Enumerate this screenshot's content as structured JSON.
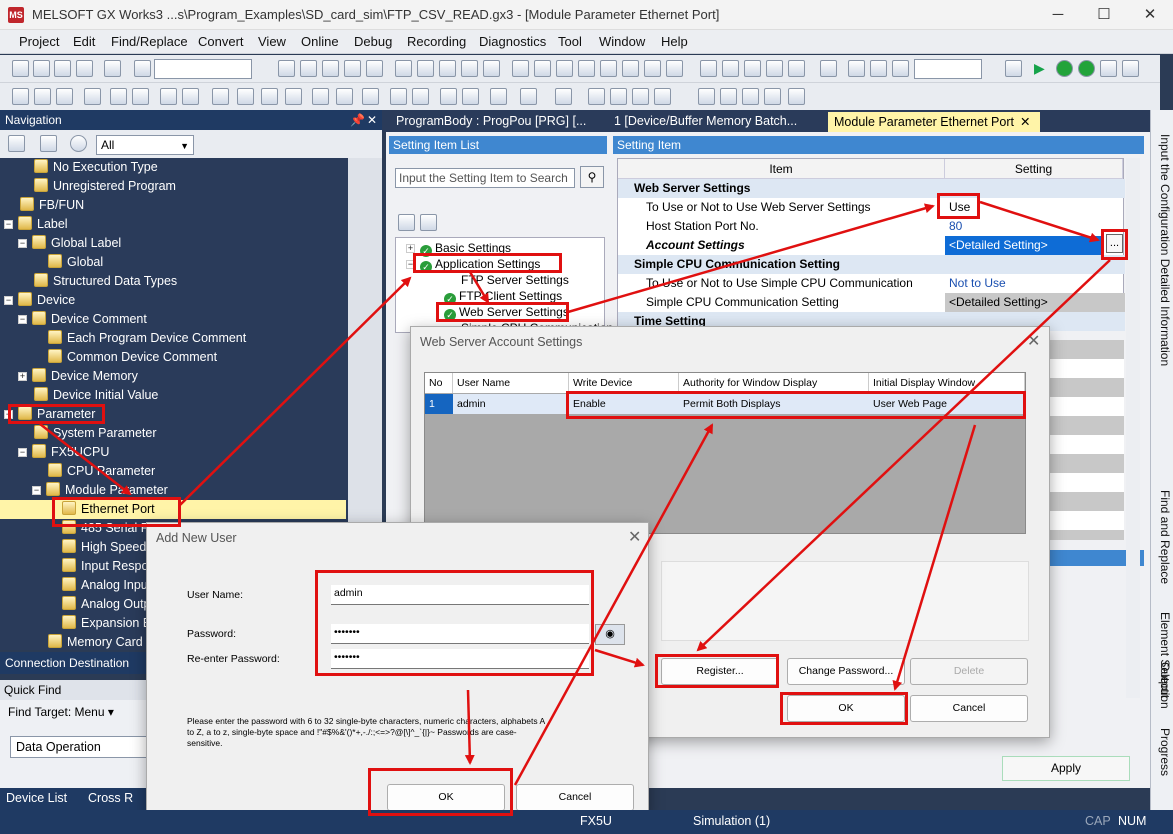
{
  "window": {
    "title": "MELSOFT GX Works3 ...s\\Program_Examples\\SD_card_sim\\FTP_CSV_READ.gx3 - [Module Parameter Ethernet Port]",
    "app_icon": "MELSOFT",
    "minimize": "─",
    "maximize": "☐",
    "close": "✕"
  },
  "menu": [
    "Project",
    "Edit",
    "Find/Replace",
    "Convert",
    "View",
    "Online",
    "Debug",
    "Recording",
    "Diagnostics",
    "Tool",
    "Window",
    "Help"
  ],
  "right_panel_tabs": [
    "Input the Configuration Detailed Information",
    "Find and Replace",
    "Element Selection",
    "Output",
    "Progress"
  ],
  "navigation": {
    "header": "Navigation",
    "pin": "📌",
    "close": "✕",
    "filter_value": "All",
    "items": [
      {
        "label": "No Execution Type",
        "expander": ""
      },
      {
        "label": "Unregistered Program",
        "expander": ""
      },
      {
        "label": "FB/FUN",
        "expander": ""
      },
      {
        "label": "Label",
        "expander": "−"
      },
      {
        "label": "Global Label",
        "expander": "−"
      },
      {
        "label": "Global",
        "expander": ""
      },
      {
        "label": "Structured Data Types",
        "expander": ""
      },
      {
        "label": "Device",
        "expander": "−"
      },
      {
        "label": "Device Comment",
        "expander": "−"
      },
      {
        "label": "Each Program Device Comment",
        "expander": ""
      },
      {
        "label": "Common Device Comment",
        "expander": ""
      },
      {
        "label": "Device Memory",
        "expander": "+"
      },
      {
        "label": "Device Initial Value",
        "expander": ""
      },
      {
        "label": "Parameter",
        "expander": "−"
      },
      {
        "label": "System Parameter",
        "expander": ""
      },
      {
        "label": "FX5UCPU",
        "expander": "−"
      },
      {
        "label": "CPU Parameter",
        "expander": ""
      },
      {
        "label": "Module Parameter",
        "expander": "−"
      },
      {
        "label": "Ethernet Port",
        "expander": ""
      },
      {
        "label": "485 Serial Port",
        "expander": ""
      },
      {
        "label": "High Speed I/O",
        "expander": ""
      },
      {
        "label": "Input Response Time",
        "expander": ""
      },
      {
        "label": "Analog Input",
        "expander": ""
      },
      {
        "label": "Analog Output",
        "expander": ""
      },
      {
        "label": "Expansion Board",
        "expander": ""
      },
      {
        "label": "Memory Card Parameter",
        "expander": ""
      }
    ]
  },
  "connection_destination": "Connection Destination",
  "quick_find": {
    "header": "Quick Find",
    "find_target": "Find Target: Menu ▾",
    "value": "Data Operation"
  },
  "bottom_tabs": [
    "Device List",
    "Cross R"
  ],
  "doc_tabs": [
    "ProgramBody : ProgPou [PRG] [...",
    "1 [Device/Buffer Memory Batch...",
    "Module Parameter Ethernet Port"
  ],
  "setting_item_list": {
    "header": "Setting Item List",
    "search_placeholder": "Input the Setting Item to Search",
    "tree": [
      "Basic Settings",
      "Application Settings",
      "FTP Server Settings",
      "FTP Client Settings",
      "Web Server Settings",
      "Simple CPU Communication Setting"
    ]
  },
  "setting_item": {
    "header": "Setting Item",
    "col_item": "Item",
    "col_setting": "Setting",
    "rows": [
      {
        "type": "section",
        "name": "Web Server Settings",
        "value": ""
      },
      {
        "type": "row",
        "name": "To Use or Not to Use Web Server Settings",
        "value": "Use"
      },
      {
        "type": "row",
        "name": "Host Station Port No.",
        "value": "80"
      },
      {
        "type": "row",
        "name": "Account Settings",
        "value": "<Detailed Setting>"
      },
      {
        "type": "section",
        "name": "Simple CPU Communication Setting",
        "value": ""
      },
      {
        "type": "row",
        "name": "To Use or Not to Use Simple CPU Communication",
        "value": "Not to Use"
      },
      {
        "type": "row",
        "name": "Simple CPU Communication Setting",
        "value": "<Detailed Setting>"
      },
      {
        "type": "section",
        "name": "Time Setting",
        "value": ""
      }
    ],
    "detail_button": "..."
  },
  "apply": "Apply",
  "web_server_dialog": {
    "title": "Web Server Account Settings",
    "close": "✕",
    "columns": [
      "No",
      "User Name",
      "Write Device",
      "Authority for Window Display",
      "Initial Display Window"
    ],
    "row": [
      "1",
      "admin",
      "Enable",
      "Permit Both Displays",
      "User Web Page"
    ],
    "register": "Register...",
    "change_password": "Change Password...",
    "delete": "Delete",
    "ok": "OK",
    "cancel": "Cancel"
  },
  "add_user_dialog": {
    "title": "Add New User",
    "close": "✕",
    "user_name_label": "User Name:",
    "user_name": "admin",
    "password_label": "Password:",
    "password": "•••••••",
    "reenter_label": "Re-enter Password:",
    "reenter": "•••••••",
    "note": "Please enter the password with 6 to 32 single-byte characters, numeric characters, alphabets A to Z, a to z, single-byte space and !\"#$%&'()*+,-./:;<=>?@[\\]^_`{|}~ Passwords are case-sensitive.",
    "ok": "OK",
    "cancel": "Cancel"
  },
  "status": {
    "model": "FX5U",
    "simulation": "Simulation (1)",
    "cap": "CAP",
    "num": "NUM"
  },
  "colors": {
    "annotation": "#e01010",
    "nav_bg": "#2a3b5a",
    "selection": "#fff4a8",
    "header_blue": "#3f87d0"
  }
}
